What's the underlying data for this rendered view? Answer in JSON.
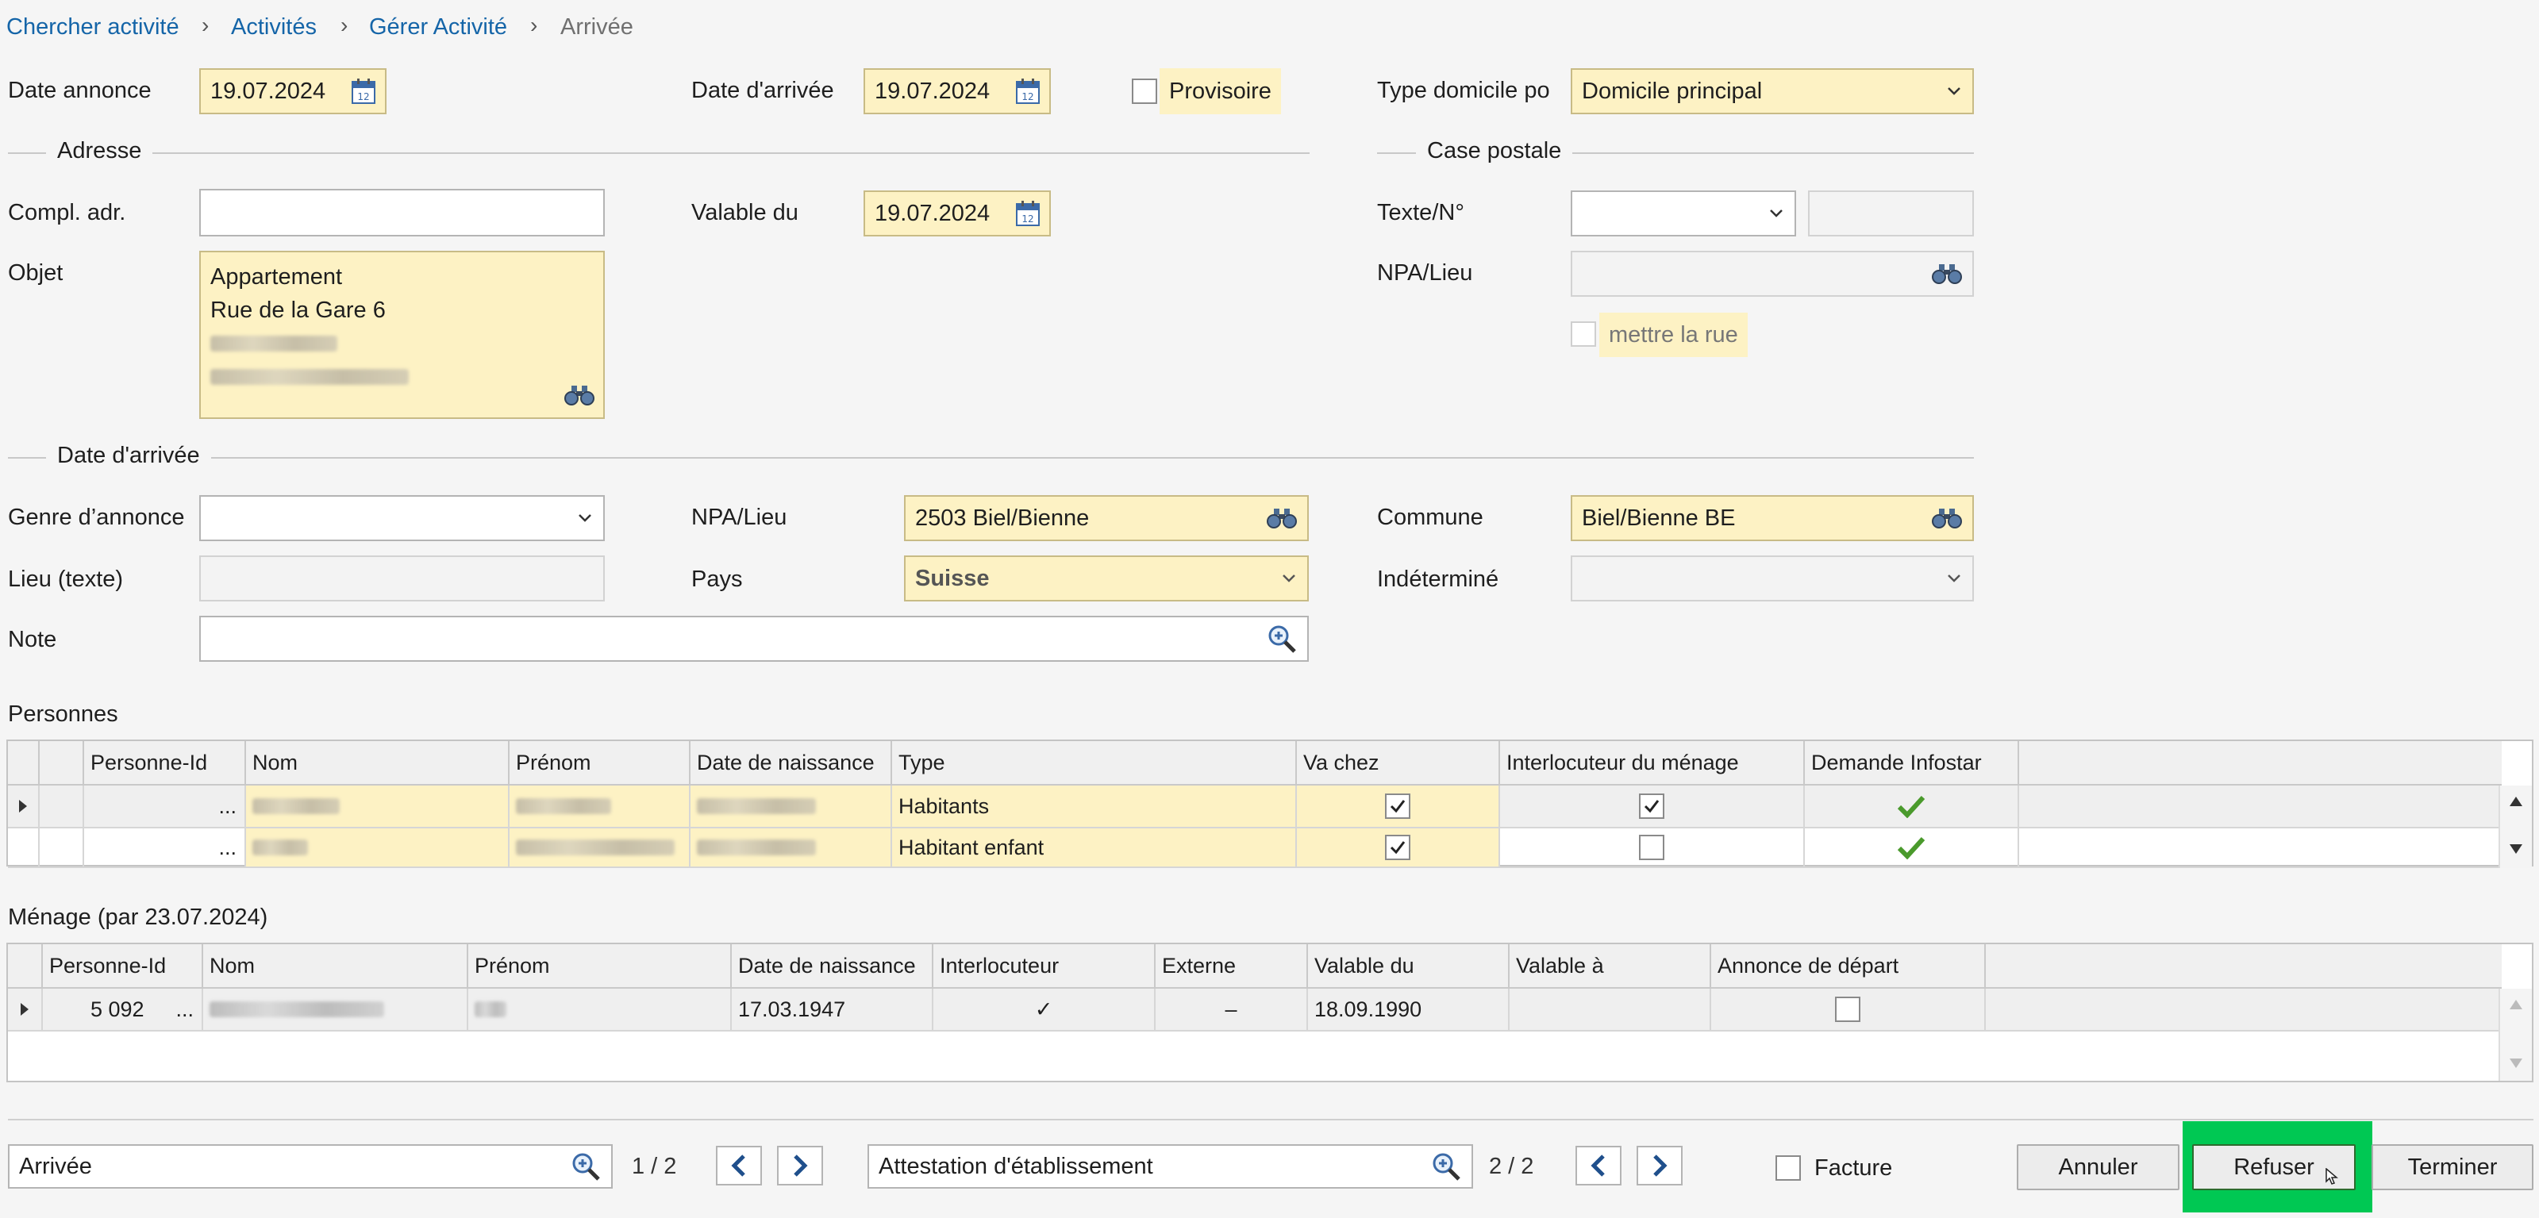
{
  "breadcrumb": {
    "items": [
      "Chercher activité",
      "Activités",
      "Gérer Activité"
    ],
    "current": "Arrivée",
    "separator": ">"
  },
  "header": {
    "date_annonce_label": "Date annonce",
    "date_annonce_value": "19.07.2024",
    "date_arrivee_label": "Date d'arrivée",
    "date_arrivee_value": "19.07.2024",
    "provisoire_label": "Provisoire",
    "type_domicile_label": "Type domicile po",
    "type_domicile_value": "Domicile principal"
  },
  "adresse": {
    "section_title": "Adresse",
    "compl_adr_label": "Compl. adr.",
    "compl_adr_value": "",
    "valable_du_label": "Valable du",
    "valable_du_value": "19.07.2024",
    "objet_label": "Objet",
    "objet_line1": "Appartement",
    "objet_line2": "Rue de la Gare 6"
  },
  "case_postale": {
    "section_title": "Case postale",
    "texte_label": "Texte/N°",
    "npa_label": "NPA/Lieu",
    "mettre_rue_label": "mettre la rue"
  },
  "arrivee": {
    "section_title": "Date d'arrivée",
    "genre_label": "Genre d’annonce",
    "npa_label": "NPA/Lieu",
    "npa_value": "2503 Biel/Bienne",
    "commune_label": "Commune",
    "commune_value": "Biel/Bienne BE",
    "lieu_label": "Lieu (texte)",
    "pays_label": "Pays",
    "pays_value": "Suisse",
    "indetermine_label": "Indéterminé",
    "note_label": "Note"
  },
  "personnes": {
    "title": "Personnes",
    "columns": [
      "Personne-Id",
      "Nom",
      "Prénom",
      "Date de naissance",
      "Type",
      "Va chez",
      "Interlocuteur du ménage",
      "Demande Infostar"
    ],
    "rows": [
      {
        "id": "...",
        "type": "Habitants",
        "va_chez": true,
        "interlocuteur": true,
        "infostar": true
      },
      {
        "id": "...",
        "type": "Habitant enfant",
        "va_chez": true,
        "interlocuteur": false,
        "infostar": true
      }
    ]
  },
  "menage": {
    "title": "Ménage (par 23.07.2024)",
    "columns": [
      "Personne-Id",
      "Nom",
      "Prénom",
      "Date de naissance",
      "Interlocuteur",
      "Externe",
      "Valable du",
      "Valable à",
      "Annonce de départ"
    ],
    "rows": [
      {
        "id": "5 092",
        "dots": "...",
        "naissance": "17.03.1947",
        "interlocuteur": "✓",
        "externe": "–",
        "valable_du": "18.09.1990",
        "valable_a": "",
        "annonce": false
      }
    ]
  },
  "footer": {
    "left_value": "Arrivée",
    "left_pager": "1 / 2",
    "mid_value": "Attestation d'établissement",
    "mid_pager": "2 / 2",
    "facture_label": "Facture",
    "annuler_label": "Annuler",
    "refuser_label": "Refuser",
    "terminer_label": "Terminer"
  },
  "colors": {
    "required_field": "#fdf2c4",
    "link": "#1565a8",
    "highlight": "#00c853",
    "check_green": "#4a9a2c"
  }
}
